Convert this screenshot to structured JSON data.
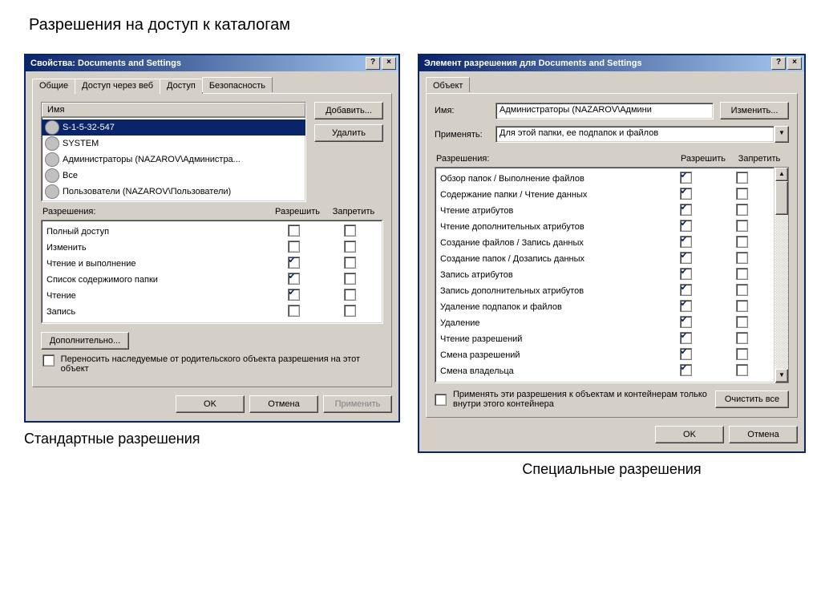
{
  "main_title": "Разрешения на доступ к каталогам",
  "left": {
    "window_title": "Свойства: Documents and Settings",
    "tabs": [
      "Общие",
      "Доступ через веб",
      "Доступ",
      "Безопасность"
    ],
    "active_tab_index": 3,
    "list_header": "Имя",
    "add_btn": "Добавить...",
    "remove_btn": "Удалить",
    "users": [
      {
        "name": "S-1-5-32-547",
        "selected": true
      },
      {
        "name": "SYSTEM",
        "selected": false
      },
      {
        "name": "Администраторы (NAZAROV\\Администра...",
        "selected": false
      },
      {
        "name": "Все",
        "selected": false
      },
      {
        "name": "Пользователи (NAZAROV\\Пользователи)",
        "selected": false
      }
    ],
    "perm_head": {
      "label": "Разрешения:",
      "allow": "Разрешить",
      "deny": "Запретить"
    },
    "permissions": [
      {
        "name": "Полный доступ",
        "allow": false,
        "deny": false
      },
      {
        "name": "Изменить",
        "allow": false,
        "deny": false
      },
      {
        "name": "Чтение и выполнение",
        "allow": true,
        "deny": false
      },
      {
        "name": "Список содержимого папки",
        "allow": true,
        "deny": false
      },
      {
        "name": "Чтение",
        "allow": true,
        "deny": false
      },
      {
        "name": "Запись",
        "allow": false,
        "deny": false
      }
    ],
    "advanced_btn": "Дополнительно...",
    "inherit_label": "Переносить наследуемые от родительского объекта разрешения на этот объект",
    "ok": "OK",
    "cancel": "Отмена",
    "apply": "Применить",
    "caption": "Стандартные разрешения"
  },
  "right": {
    "window_title": "Элемент разрешения для Documents and Settings",
    "tab": "Объект",
    "name_label": "Имя:",
    "name_value": "Администраторы (NAZAROV\\Админи",
    "change_btn": "Изменить...",
    "apply_label": "Применять:",
    "apply_value": "Для этой папки, ее подпапок и файлов",
    "perm_head": {
      "label": "Разрешения:",
      "allow": "Разрешить",
      "deny": "Запретить"
    },
    "permissions": [
      {
        "name": "Обзор папок / Выполнение файлов",
        "allow": true,
        "deny": false
      },
      {
        "name": "Содержание папки / Чтение данных",
        "allow": true,
        "deny": false
      },
      {
        "name": "Чтение атрибутов",
        "allow": true,
        "deny": false
      },
      {
        "name": "Чтение дополнительных атрибутов",
        "allow": true,
        "deny": false
      },
      {
        "name": "Создание файлов / Запись данных",
        "allow": true,
        "deny": false
      },
      {
        "name": "Создание папок / Дозапись данных",
        "allow": true,
        "deny": false
      },
      {
        "name": "Запись атрибутов",
        "allow": true,
        "deny": false
      },
      {
        "name": "Запись дополнительных атрибутов",
        "allow": true,
        "deny": false
      },
      {
        "name": "Удаление подпапок и файлов",
        "allow": true,
        "deny": false
      },
      {
        "name": "Удаление",
        "allow": true,
        "deny": false
      },
      {
        "name": "Чтение разрешений",
        "allow": true,
        "deny": false
      },
      {
        "name": "Смена разрешений",
        "allow": true,
        "deny": false
      },
      {
        "name": "Смена владельца",
        "allow": true,
        "deny": false
      }
    ],
    "apply_children_label": "Применять эти разрешения к объектам и контейнерам только внутри этого контейнера",
    "clear_btn": "Очистить все",
    "ok": "OK",
    "cancel": "Отмена",
    "caption": "Специальные разрешения"
  }
}
